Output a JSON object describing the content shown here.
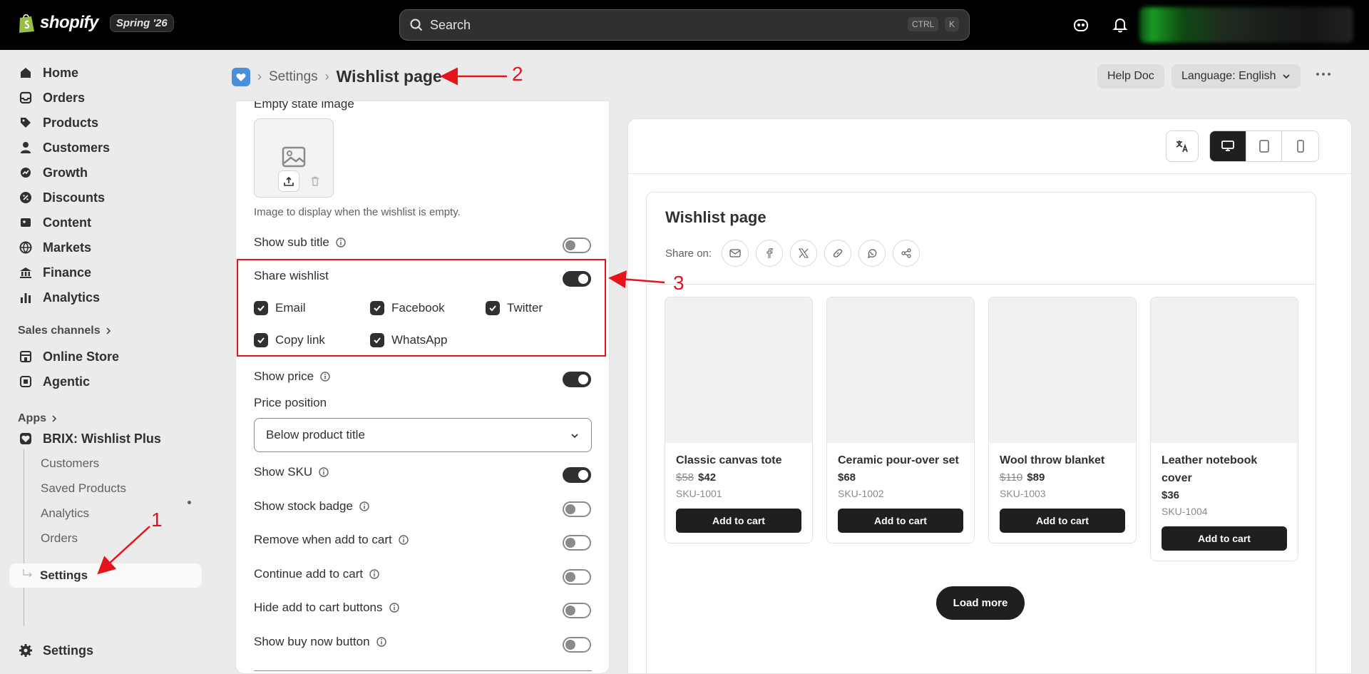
{
  "topbar": {
    "brand": "shopify",
    "season": "Spring '26",
    "search_placeholder": "Search",
    "shortcut_ctrl": "CTRL",
    "shortcut_k": "K"
  },
  "sidebar": {
    "items": [
      {
        "label": "Home",
        "icon": "home-icon"
      },
      {
        "label": "Orders",
        "icon": "inbox-icon"
      },
      {
        "label": "Products",
        "icon": "tag-icon"
      },
      {
        "label": "Customers",
        "icon": "person-icon"
      },
      {
        "label": "Growth",
        "icon": "growth-icon"
      },
      {
        "label": "Discounts",
        "icon": "discount-icon"
      },
      {
        "label": "Content",
        "icon": "content-icon"
      },
      {
        "label": "Markets",
        "icon": "globe-icon"
      },
      {
        "label": "Finance",
        "icon": "bank-icon"
      },
      {
        "label": "Analytics",
        "icon": "bar-chart-icon"
      }
    ],
    "sales_channels_label": "Sales channels",
    "channels": [
      {
        "label": "Online Store",
        "icon": "store-icon"
      },
      {
        "label": "Agentic",
        "icon": "agentic-icon"
      }
    ],
    "apps_label": "Apps",
    "app_name": "BRIX: Wishlist Plus",
    "app_sub_items": [
      "Customers",
      "Saved Products",
      "Analytics",
      "Orders",
      "Settings"
    ],
    "footer_settings": "Settings"
  },
  "header": {
    "crumb_settings": "Settings",
    "page_title": "Wishlist page",
    "help_doc": "Help Doc",
    "language": "Language: English"
  },
  "settings_panel": {
    "empty_state_label": "Empty state image",
    "empty_state_help": "Image to display when the wishlist is empty.",
    "show_sub_title": "Show sub title",
    "share_wishlist": "Share wishlist",
    "share_options": [
      "Email",
      "Facebook",
      "Twitter",
      "Copy link",
      "WhatsApp"
    ],
    "show_price": "Show price",
    "price_position_label": "Price position",
    "price_position_value": "Below product title",
    "show_sku": "Show SKU",
    "show_stock_badge": "Show stock badge",
    "remove_when_add": "Remove when add to cart",
    "continue_add": "Continue add to cart",
    "hide_add_buttons": "Hide add to cart buttons",
    "show_buy_now": "Show buy now button",
    "toggles": {
      "show_sub_title": false,
      "share_wishlist": true,
      "show_price": true,
      "show_sku": true,
      "show_stock_badge": false,
      "remove_when_add": false,
      "continue_add": false,
      "hide_add_buttons": false,
      "show_buy_now": false
    }
  },
  "preview": {
    "title": "Wishlist page",
    "share_on": "Share on:",
    "share_icons": [
      "mail-icon",
      "facebook-icon",
      "x-icon",
      "link-icon",
      "whatsapp-icon",
      "share-icon"
    ],
    "products": [
      {
        "name": "Classic canvas tote",
        "old_price": "$58",
        "price": "$42",
        "sku": "SKU-1001",
        "button": "Add to cart"
      },
      {
        "name": "Ceramic pour-over set",
        "old_price": "",
        "price": "$68",
        "sku": "SKU-1002",
        "button": "Add to cart"
      },
      {
        "name": "Wool throw blanket",
        "old_price": "$110",
        "price": "$89",
        "sku": "SKU-1003",
        "button": "Add to cart"
      },
      {
        "name": "Leather notebook cover",
        "old_price": "",
        "price": "$36",
        "sku": "SKU-1004",
        "button": "Add to cart"
      }
    ],
    "load_more": "Load more"
  },
  "annotations": {
    "one": "1",
    "two": "2",
    "three": "3"
  },
  "colors": {
    "annotation": "#e8121c",
    "topbar": "#000000",
    "accent_dark": "#1f1f1f"
  }
}
